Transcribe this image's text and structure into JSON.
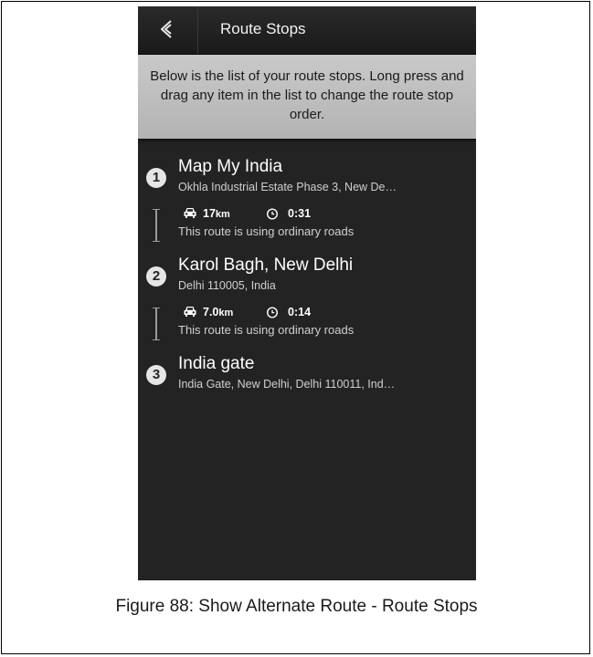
{
  "header": {
    "title": "Route Stops",
    "back_icon": "back-chevron-icon"
  },
  "info": {
    "text": "Below is the list of your route stops. Long press and drag any item in the list to change the route stop order."
  },
  "stops": [
    {
      "number": "1",
      "name": "Map My India",
      "address": "Okhla Industrial Estate Phase 3, New De…"
    },
    {
      "number": "2",
      "name": "Karol Bagh, New Delhi",
      "address": "Delhi 110005, India"
    },
    {
      "number": "3",
      "name": "India gate",
      "address": "India Gate, New Delhi, Delhi 110011, Ind…"
    }
  ],
  "segments": [
    {
      "distance": "17",
      "unit": "km",
      "time": "0:31",
      "note": "This route is using ordinary roads"
    },
    {
      "distance": "7.0",
      "unit": "km",
      "time": "0:14",
      "note": "This route is using ordinary roads"
    }
  ],
  "caption": "Figure 88: Show Alternate Route - Route Stops",
  "colors": {
    "screen_bg": "#232323",
    "info_bg": "#bdbdbd",
    "text": "#ffffff"
  }
}
